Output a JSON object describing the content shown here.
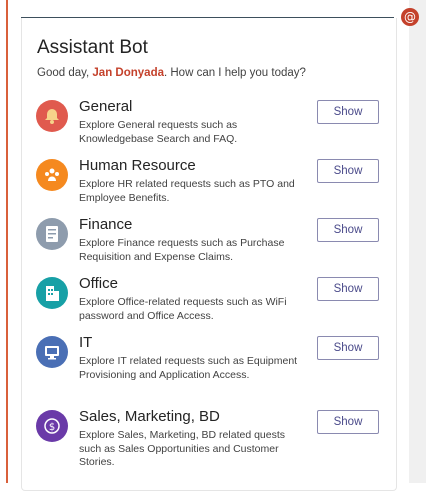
{
  "header": {
    "mention_icon": "at-icon"
  },
  "card": {
    "title": "Assistant Bot",
    "greeting_prefix": "Good day, ",
    "user_name": "Jan Donyada",
    "greeting_suffix": ". How can I help you today?"
  },
  "items": [
    {
      "name": "General",
      "description": "Explore General requests such as Knowledgebase Search and FAQ.",
      "button": "Show",
      "icon": "bell-icon",
      "color": "#e05a4e"
    },
    {
      "name": "Human Resource",
      "description": "Explore HR related requests such as PTO and Employee Benefits.",
      "button": "Show",
      "icon": "people-icon",
      "color": "#f5891f"
    },
    {
      "name": "Finance",
      "description": "Explore Finance requests such as Purchase Requisition and Expense Claims.",
      "button": "Show",
      "icon": "receipt-icon",
      "color": "#8e9cad"
    },
    {
      "name": "Office",
      "description": "Explore Office-related requests such as WiFi password and Office Access.",
      "button": "Show",
      "icon": "building-icon",
      "color": "#17a0a6"
    },
    {
      "name": "IT",
      "description": "Explore IT related requests such as Equipment Provisioning and Application Access.",
      "button": "Show",
      "icon": "monitor-icon",
      "color": "#4a6fb5"
    },
    {
      "name": "Sales, Marketing, BD",
      "description": "Explore Sales, Marketing, BD related quests such as Sales Opportunities and Customer Stories.",
      "button": "Show",
      "icon": "dollar-icon",
      "color": "#6a3aa8"
    }
  ]
}
